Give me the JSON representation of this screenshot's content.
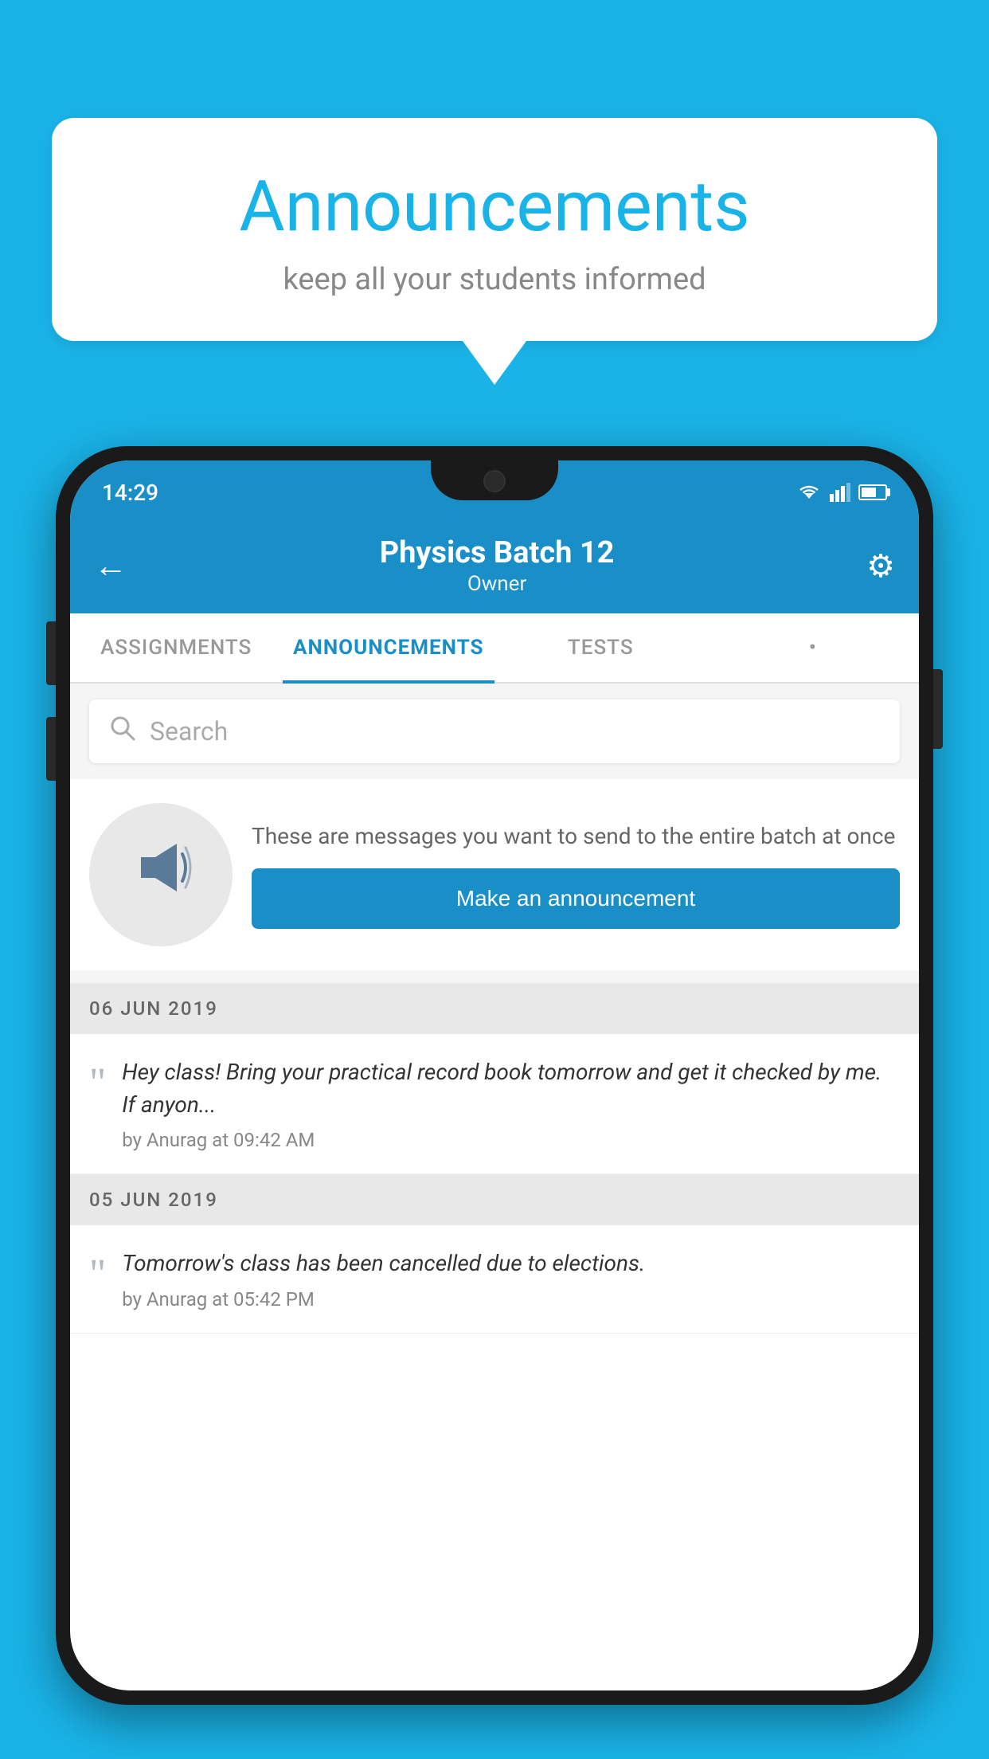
{
  "background_color": "#1ab3e8",
  "speech_bubble": {
    "title": "Announcements",
    "subtitle": "keep all your students informed"
  },
  "status_bar": {
    "time": "14:29"
  },
  "app_bar": {
    "title": "Physics Batch 12",
    "subtitle": "Owner",
    "back_label": "←",
    "settings_label": "⚙"
  },
  "tabs": [
    {
      "label": "ASSIGNMENTS",
      "active": false
    },
    {
      "label": "ANNOUNCEMENTS",
      "active": true
    },
    {
      "label": "TESTS",
      "active": false
    },
    {
      "label": "•",
      "active": false
    }
  ],
  "search": {
    "placeholder": "Search"
  },
  "announcement_promo": {
    "description": "These are messages you want to send to the entire batch at once",
    "button_label": "Make an announcement"
  },
  "date_groups": [
    {
      "date": "06  JUN  2019",
      "items": [
        {
          "text": "Hey class! Bring your practical record book tomorrow and get it checked by me. If anyon...",
          "author": "by Anurag at 09:42 AM"
        }
      ]
    },
    {
      "date": "05  JUN  2019",
      "items": [
        {
          "text": "Tomorrow's class has been cancelled due to elections.",
          "author": "by Anurag at 05:42 PM"
        }
      ]
    }
  ]
}
